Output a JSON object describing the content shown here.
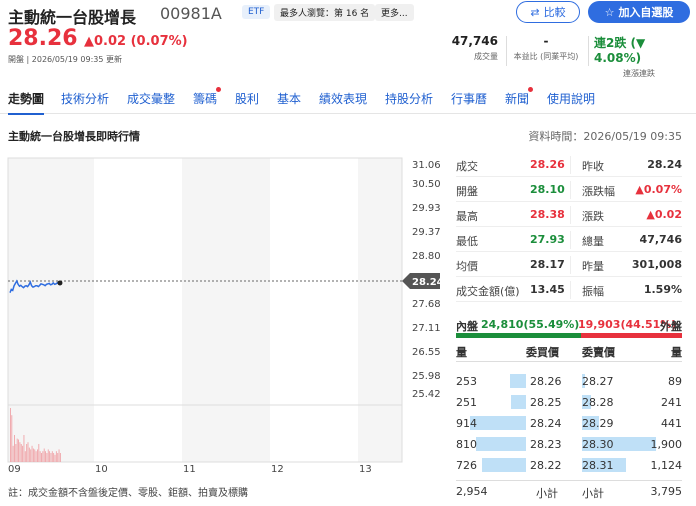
{
  "header": {
    "name": "主動統一台股增長",
    "code": "00981A",
    "etf_tag": "ETF",
    "popularity_tag": "最多人瀏覽：第 16 名",
    "more_tag": "更多...",
    "compare_label": "比較",
    "add_watchlist_label": "加入自選股"
  },
  "quote": {
    "price": "28.26",
    "change": "▲0.02 (0.07%)",
    "status": "開盤 | 2026/05/19 09:35 更新",
    "volume": "47,746",
    "volume_label": "成交量",
    "pb": "-",
    "pb_label": "本益比 (同業平均)",
    "streak": "連2跌 (▼ 4.08%)",
    "streak_label": "連漲連跌"
  },
  "tabs": [
    "走勢圖",
    "技術分析",
    "成交彙整",
    "籌碼",
    "股利",
    "基本",
    "績效表現",
    "持股分析",
    "行事曆",
    "新聞",
    "使用說明"
  ],
  "section": {
    "title": "主動統一台股增長即時行情",
    "timestamp": "資料時間：2026/05/19 09:35"
  },
  "chart_data": {
    "type": "line",
    "y_ticks": [
      "31.06",
      "30.50",
      "29.93",
      "29.37",
      "28.80",
      "28.24",
      "27.68",
      "27.11",
      "26.55",
      "25.98",
      "25.42"
    ],
    "x_ticks": [
      "09",
      "10",
      "11",
      "12",
      "13"
    ],
    "reference_price": "28.24",
    "ylim": [
      25.42,
      31.06
    ],
    "price_series": [
      28.15,
      28.22,
      28.2,
      28.3,
      28.35,
      28.4,
      28.33,
      28.29,
      28.31,
      28.28,
      28.26,
      28.29,
      28.3,
      28.28,
      28.32,
      28.38,
      28.3,
      28.27,
      28.28,
      28.3,
      28.3,
      28.28,
      28.31,
      28.34,
      28.33,
      28.32,
      28.3,
      28.33,
      28.34,
      28.35,
      28.32,
      28.33,
      28.36,
      28.33,
      28.34,
      28.36,
      28.35,
      28.36
    ],
    "volume_series": [
      60,
      52,
      18,
      30,
      20,
      26,
      25,
      22,
      20,
      18,
      30,
      12,
      20,
      22,
      16,
      14,
      18,
      15,
      14,
      12,
      14,
      20,
      12,
      10,
      12,
      15,
      12,
      10,
      14,
      12,
      10,
      12,
      10,
      8,
      12,
      10,
      14,
      10
    ]
  },
  "stats": [
    {
      "l1": "成交",
      "v1": "28.26",
      "c1": "red",
      "l2": "昨收",
      "v2": "28.24",
      "c2": ""
    },
    {
      "l1": "開盤",
      "v1": "28.10",
      "c1": "green",
      "l2": "漲跌幅",
      "v2": "▲0.07%",
      "c2": "red"
    },
    {
      "l1": "最高",
      "v1": "28.38",
      "c1": "red",
      "l2": "漲跌",
      "v2": "▲0.02",
      "c2": "red"
    },
    {
      "l1": "最低",
      "v1": "27.93",
      "c1": "green",
      "l2": "總量",
      "v2": "47,746",
      "c2": ""
    },
    {
      "l1": "均價",
      "v1": "28.17",
      "c1": "",
      "l2": "昨量",
      "v2": "301,008",
      "c2": ""
    },
    {
      "l1": "成交金額(億)",
      "v1": "13.45",
      "c1": "",
      "l2": "振幅",
      "v2": "1.59%",
      "c2": ""
    }
  ],
  "inout": {
    "inner_label": "內盤",
    "inner_value": "24,810(55.49%)",
    "inner_pct": 55.49,
    "outer_value": "19,903(44.51%)",
    "outer_label": "外盤"
  },
  "order_book": {
    "headers": [
      "量",
      "委買價",
      "委賣價",
      "量"
    ],
    "rows": [
      {
        "bq": "253",
        "bp": "28.26",
        "sp": "28.27",
        "sq": "89"
      },
      {
        "bq": "251",
        "bp": "28.25",
        "sp": "28.28",
        "sq": "241"
      },
      {
        "bq": "914",
        "bp": "28.24",
        "sp": "28.29",
        "sq": "441"
      },
      {
        "bq": "810",
        "bp": "28.23",
        "sp": "28.30",
        "sq": "1,900"
      },
      {
        "bq": "726",
        "bp": "28.22",
        "sp": "28.31",
        "sq": "1,124"
      }
    ],
    "bid_total": "2,954",
    "bid_total_label": "小計",
    "ask_total_label": "小計",
    "ask_total": "3,795"
  },
  "note": "註：成交金額不含盤後定價、零股、鉅額、拍賣及標購",
  "colors": {
    "up": "#e7313d",
    "down": "#1b8e3b",
    "accent": "#2f6de0",
    "bar": "#bfe0f7"
  }
}
